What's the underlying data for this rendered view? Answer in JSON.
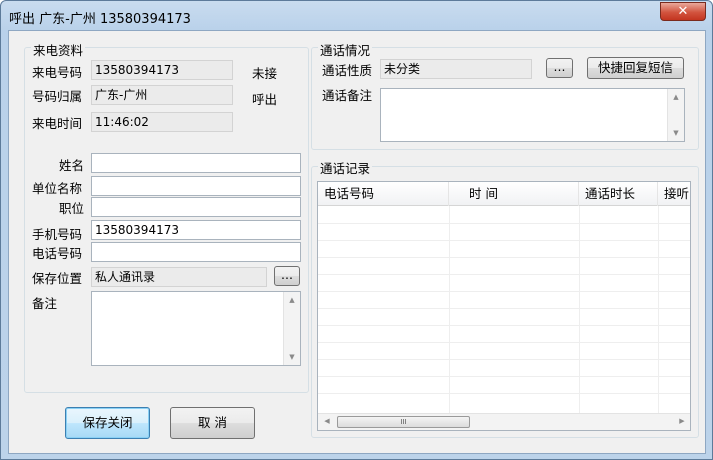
{
  "window": {
    "title": "呼出 广东-广州 13580394173",
    "close_glyph": "✕"
  },
  "caller_info": {
    "group_title": "来电资料",
    "phone_label": "来电号码",
    "phone_value": "13580394173",
    "status_unanswered": "未接",
    "location_label": "号码归属",
    "location_value": "广东-广州",
    "status_outgoing": "呼出",
    "time_label": "来电时间",
    "time_value": "11:46:02"
  },
  "contact_form": {
    "name_label": "姓名",
    "name_value": "",
    "company_label": "单位名称",
    "company_value": "",
    "position_label": "职位",
    "position_value": "",
    "mobile_label": "手机号码",
    "mobile_value": "13580394173",
    "phone_label": "电话号码",
    "phone_value": "",
    "save_location_label": "保存位置",
    "save_location_value": "私人通讯录",
    "browse_label": "...",
    "note_label": "备注",
    "note_value": ""
  },
  "call_status": {
    "group_title": "通话情况",
    "nature_label": "通话性质",
    "nature_value": "未分类",
    "browse_label": "...",
    "sms_reply_label": "快捷回复短信",
    "note_label": "通话备注",
    "note_value": ""
  },
  "call_log": {
    "group_title": "通话记录",
    "columns": [
      "电话号码",
      "时 间",
      "通话时长",
      "接听"
    ]
  },
  "buttons": {
    "save_close": "保存关闭",
    "cancel": "取 消"
  },
  "icons": {
    "scroll_up": "▲",
    "scroll_down": "▼",
    "scroll_left": "◀",
    "scroll_right": "▶",
    "thumb_grip": "III"
  }
}
